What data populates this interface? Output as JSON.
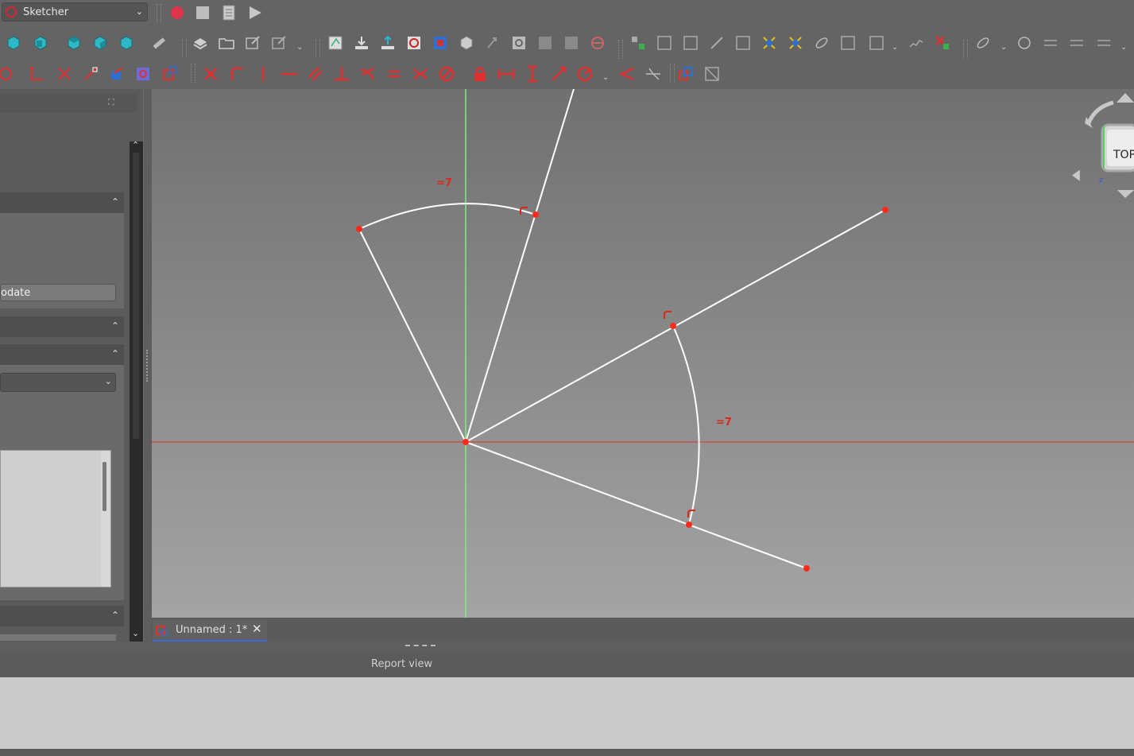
{
  "toolbar": {
    "workbench": "Sketcher",
    "macro_record_icon": "record-macro-icon",
    "macro_stop_icon": "stop-macro-icon",
    "macros_icon": "macros-icon",
    "run_macro_icon": "run-macro-icon"
  },
  "left_panel": {
    "update_button": "odate"
  },
  "viewport": {
    "navcube_face": "TOP",
    "constraint_labels": [
      "=7",
      "=7"
    ]
  },
  "document_tab": {
    "title": "Unnamed : 1*"
  },
  "report": {
    "title": "Report view"
  },
  "colors": {
    "geometry": "#ffffff",
    "points": "#ff2a1a",
    "constraints": "#d8281c",
    "x_axis": "#e03030",
    "y_axis": "#7cf07c",
    "tab_underline": "#3c6bdc"
  }
}
